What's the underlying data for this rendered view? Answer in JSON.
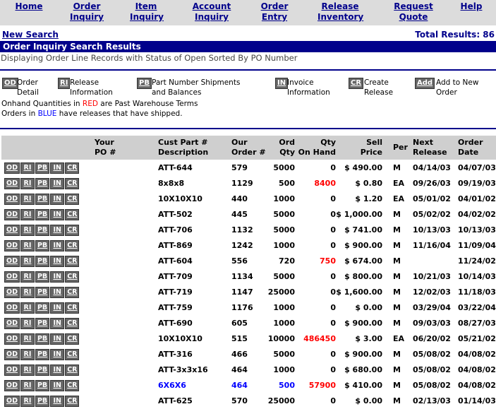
{
  "nav": {
    "items": [
      {
        "label": "Home",
        "name": "nav-home"
      },
      {
        "label": "Order\nInquiry",
        "name": "nav-order-inquiry"
      },
      {
        "label": "Item\nInquiry",
        "name": "nav-item-inquiry"
      },
      {
        "label": "Account\nInquiry",
        "name": "nav-account-inquiry"
      },
      {
        "label": "Order\nEntry",
        "name": "nav-order-entry"
      },
      {
        "label": "Release\nInventory",
        "name": "nav-release-inventory"
      },
      {
        "label": "Request\nQuote",
        "name": "nav-request-quote"
      },
      {
        "label": "Help",
        "name": "nav-help"
      }
    ]
  },
  "subhead": {
    "new_search": "New Search",
    "total_results": "Total Results: 86"
  },
  "title": "Order Inquiry Search Results",
  "displaying": "Displaying Order Line Records with Status of Open Sorted By PO Number",
  "legend": [
    {
      "code": "OD",
      "text": "Order\nDetail"
    },
    {
      "code": "RI",
      "text": "Release\nInformation"
    },
    {
      "code": "PB",
      "text": "Part Number Shipments\nand Balances"
    },
    {
      "code": "IN",
      "text": "Invoice\nInformation"
    },
    {
      "code": "CR",
      "text": "Create\nRelease"
    },
    {
      "code": "Add",
      "text": "Add to New\nOrder"
    }
  ],
  "notes": {
    "line1_pre": "Onhand Quantities in ",
    "line1_red": "RED",
    "line1_post": " are Past Warehouse Terms",
    "line2_pre": "Orders  in ",
    "line2_blue": "BLUE",
    "line2_post": " have releases that have shipped."
  },
  "table": {
    "headers": {
      "po": "Your\nPO #",
      "desc": "Cust Part #\nDescription",
      "order": "Our\nOrder #",
      "ord_qty": "Ord\nQty",
      "on_hand": "Qty\nOn Hand",
      "price": "Sell\nPrice",
      "per": "Per",
      "next": "Next\nRelease",
      "date": "Order\nDate"
    },
    "row_buttons": [
      "OD",
      "RI",
      "PB",
      "IN",
      "CR"
    ],
    "rows": [
      {
        "desc": "ATT-644",
        "order": "579",
        "ord_qty": "5000",
        "on_hand": "0",
        "price": "$ 490.00",
        "per": "M",
        "next": "04/14/03",
        "date": "04/07/03",
        "red": false,
        "blue": false
      },
      {
        "desc": "8x8x8",
        "order": "1129",
        "ord_qty": "500",
        "on_hand": "8400",
        "price": "$ 0.80",
        "per": "EA",
        "next": "09/26/03",
        "date": "09/19/03",
        "red": true,
        "blue": false
      },
      {
        "desc": "10X10X10",
        "order": "440",
        "ord_qty": "1000",
        "on_hand": "0",
        "price": "$ 1.20",
        "per": "EA",
        "next": "05/01/02",
        "date": "04/01/02",
        "red": false,
        "blue": false
      },
      {
        "desc": "ATT-502",
        "order": "445",
        "ord_qty": "5000",
        "on_hand": "0",
        "price": "$ 1,000.00",
        "per": "M",
        "next": "05/02/02",
        "date": "04/02/02",
        "red": false,
        "blue": false
      },
      {
        "desc": "ATT-706",
        "order": "1132",
        "ord_qty": "5000",
        "on_hand": "0",
        "price": "$ 741.00",
        "per": "M",
        "next": "10/13/03",
        "date": "10/13/03",
        "red": false,
        "blue": false
      },
      {
        "desc": "ATT-869",
        "order": "1242",
        "ord_qty": "1000",
        "on_hand": "0",
        "price": "$ 900.00",
        "per": "M",
        "next": "11/16/04",
        "date": "11/09/04",
        "red": false,
        "blue": false
      },
      {
        "desc": "ATT-604",
        "order": "556",
        "ord_qty": "720",
        "on_hand": "750",
        "price": "$ 674.00",
        "per": "M",
        "next": "",
        "date": "11/24/02",
        "red": true,
        "blue": false
      },
      {
        "desc": "ATT-709",
        "order": "1134",
        "ord_qty": "5000",
        "on_hand": "0",
        "price": "$ 800.00",
        "per": "M",
        "next": "10/21/03",
        "date": "10/14/03",
        "red": false,
        "blue": false
      },
      {
        "desc": "ATT-719",
        "order": "1147",
        "ord_qty": "25000",
        "on_hand": "0",
        "price": "$ 1,600.00",
        "per": "M",
        "next": "12/02/03",
        "date": "11/18/03",
        "red": false,
        "blue": false
      },
      {
        "desc": "ATT-759",
        "order": "1176",
        "ord_qty": "1000",
        "on_hand": "0",
        "price": "$ 0.00",
        "per": "M",
        "next": "03/29/04",
        "date": "03/22/04",
        "red": false,
        "blue": false
      },
      {
        "desc": "ATT-690",
        "order": "605",
        "ord_qty": "1000",
        "on_hand": "0",
        "price": "$ 900.00",
        "per": "M",
        "next": "09/03/03",
        "date": "08/27/03",
        "red": false,
        "blue": false
      },
      {
        "desc": "10X10X10",
        "order": "515",
        "ord_qty": "10000",
        "on_hand": "486450",
        "price": "$ 3.00",
        "per": "EA",
        "next": "06/20/02",
        "date": "05/21/02",
        "red": true,
        "blue": false
      },
      {
        "desc": "ATT-316",
        "order": "466",
        "ord_qty": "5000",
        "on_hand": "0",
        "price": "$ 900.00",
        "per": "M",
        "next": "05/08/02",
        "date": "04/08/02",
        "red": false,
        "blue": false
      },
      {
        "desc": "ATT-3x3x16",
        "order": "464",
        "ord_qty": "1000",
        "on_hand": "0",
        "price": "$ 680.00",
        "per": "M",
        "next": "05/08/02",
        "date": "04/08/02",
        "red": false,
        "blue": false
      },
      {
        "desc": "6X6X6",
        "order": "464",
        "ord_qty": "500",
        "on_hand": "57900",
        "price": "$ 410.00",
        "per": "M",
        "next": "05/08/02",
        "date": "04/08/02",
        "red": true,
        "blue": true
      },
      {
        "desc": "ATT-625",
        "order": "570",
        "ord_qty": "25000",
        "on_hand": "0",
        "price": "$ 0.00",
        "per": "M",
        "next": "02/13/03",
        "date": "01/14/03",
        "red": false,
        "blue": false
      }
    ]
  }
}
